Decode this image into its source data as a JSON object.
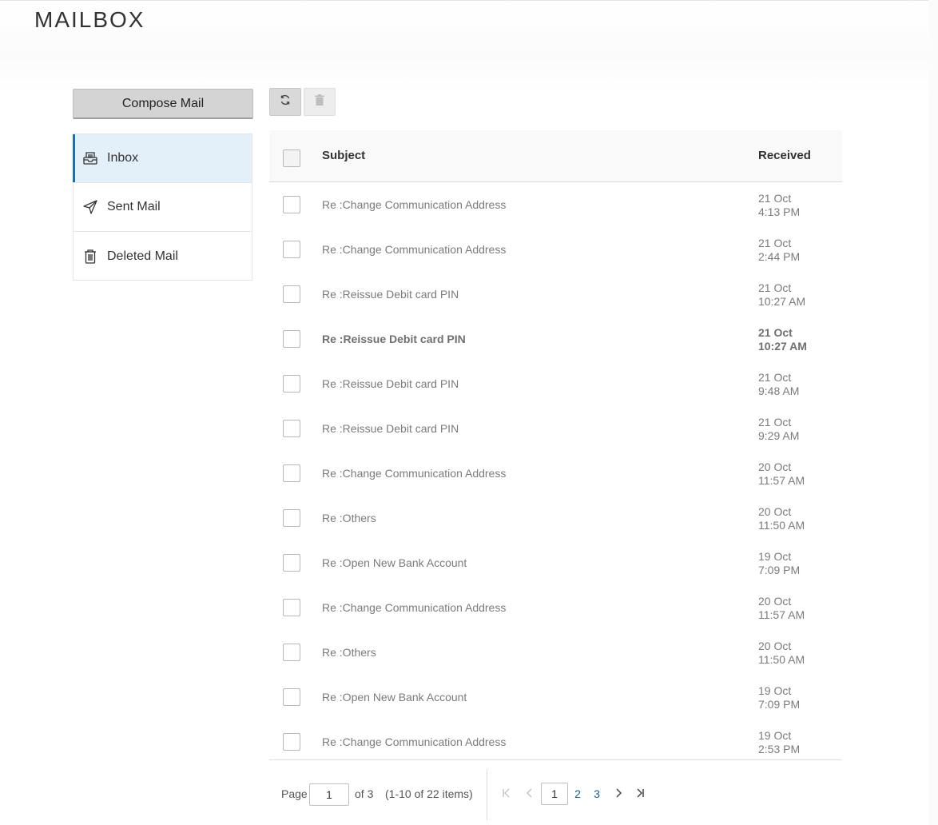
{
  "page": {
    "title": "MAILBOX"
  },
  "compose": {
    "label": "Compose Mail"
  },
  "sidebar": {
    "items": [
      {
        "label": "Inbox",
        "icon": "inbox-icon",
        "active": true
      },
      {
        "label": "Sent Mail",
        "icon": "send-icon",
        "active": false
      },
      {
        "label": "Deleted Mail",
        "icon": "trash-icon",
        "active": false
      }
    ]
  },
  "toolbar": {
    "refresh_icon": "refresh-icon",
    "delete_icon": "trash-icon"
  },
  "table": {
    "headers": {
      "subject": "Subject",
      "received": "Received"
    },
    "rows": [
      {
        "subject": "Re :Change Communication Address",
        "date": "21 Oct",
        "time": "4:13 PM",
        "unread": false
      },
      {
        "subject": "Re :Change Communication Address",
        "date": "21 Oct",
        "time": "2:44 PM",
        "unread": false
      },
      {
        "subject": "Re :Reissue Debit card PIN",
        "date": "21 Oct",
        "time": "10:27 AM",
        "unread": false
      },
      {
        "subject": "Re :Reissue Debit card PIN",
        "date": "21 Oct",
        "time": "10:27 AM",
        "unread": true
      },
      {
        "subject": "Re :Reissue Debit card PIN",
        "date": "21 Oct",
        "time": "9:48 AM",
        "unread": false
      },
      {
        "subject": "Re :Reissue Debit card PIN",
        "date": "21 Oct",
        "time": "9:29 AM",
        "unread": false
      },
      {
        "subject": "Re :Change Communication Address",
        "date": "20 Oct",
        "time": "11:57 AM",
        "unread": false
      },
      {
        "subject": "Re :Others",
        "date": "20 Oct",
        "time": "11:50 AM",
        "unread": false
      },
      {
        "subject": "Re :Open New Bank Account",
        "date": "19 Oct",
        "time": "7:09 PM",
        "unread": false
      },
      {
        "subject": "Re :Change Communication Address",
        "date": "20 Oct",
        "time": "11:57 AM",
        "unread": false
      },
      {
        "subject": "Re :Others",
        "date": "20 Oct",
        "time": "11:50 AM",
        "unread": false
      },
      {
        "subject": "Re :Open New Bank Account",
        "date": "19 Oct",
        "time": "7:09 PM",
        "unread": false
      },
      {
        "subject": "Re :Change Communication Address",
        "date": "19 Oct",
        "time": "2:53 PM",
        "unread": false
      }
    ]
  },
  "pagination": {
    "page_label": "Page",
    "current_page": "1",
    "of_label": "of 3",
    "items_summary": "(1-10 of 22 items)",
    "pages": [
      "1",
      "2",
      "3"
    ]
  },
  "colors": {
    "accent": "#1a6fb5",
    "active_bg": "#e3f0fa",
    "link": "#1a5fa0"
  }
}
